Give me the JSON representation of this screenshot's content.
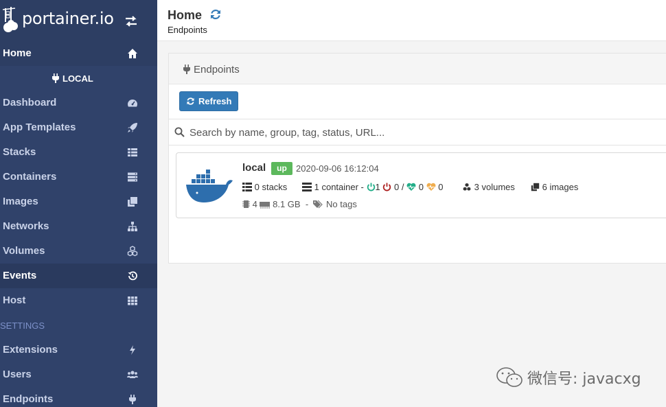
{
  "brand": {
    "name": "portainer.io"
  },
  "sidebar": {
    "home": "Home",
    "endpoint": "LOCAL",
    "items": [
      {
        "label": "Dashboard",
        "icon": "tachometer-icon"
      },
      {
        "label": "App Templates",
        "icon": "rocket-icon"
      },
      {
        "label": "Stacks",
        "icon": "th-list-icon"
      },
      {
        "label": "Containers",
        "icon": "server-icon"
      },
      {
        "label": "Images",
        "icon": "clone-icon"
      },
      {
        "label": "Networks",
        "icon": "sitemap-icon"
      },
      {
        "label": "Volumes",
        "icon": "cubes-icon"
      },
      {
        "label": "Events",
        "icon": "history-icon"
      },
      {
        "label": "Host",
        "icon": "th-icon"
      }
    ],
    "settings_title": "SETTINGS",
    "settings": [
      {
        "label": "Extensions",
        "icon": "bolt-icon"
      },
      {
        "label": "Users",
        "icon": "users-icon"
      },
      {
        "label": "Endpoints",
        "icon": "plug-icon"
      }
    ]
  },
  "header": {
    "title": "Home",
    "breadcrumb": "Endpoints"
  },
  "panel": {
    "title": "Endpoints",
    "refresh_label": "Refresh",
    "search_placeholder": "Search by name, group, tag, status, URL..."
  },
  "endpoint": {
    "name": "local",
    "status": "up",
    "date": "2020-09-06 16:12:04",
    "stacks": "0 stacks",
    "containers": "1 container -",
    "running": "1",
    "stopped": "0",
    "slash": "/",
    "healthy": "0",
    "unhealthy": "0",
    "volumes": "3 volumes",
    "images": "6 images",
    "cpu": "4",
    "memory": "8.1 GB",
    "separator": "-",
    "tags": "No tags"
  },
  "watermark": {
    "text": "微信号: javacxg"
  },
  "colors": {
    "sidebar": "#30426a",
    "accent": "#337ab7",
    "up": "#5cb85c",
    "running": "#23ae89",
    "stopped": "#ae2323",
    "unhealthy": "#f0ad4e"
  }
}
